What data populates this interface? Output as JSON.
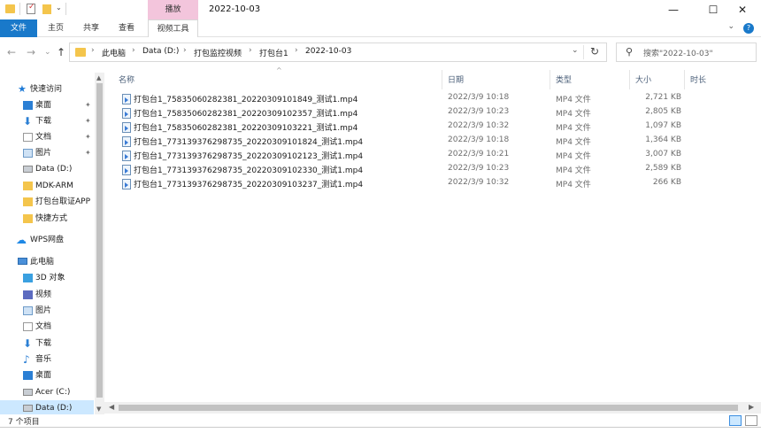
{
  "window": {
    "title": "2022-10-03",
    "context_group": "播放",
    "minimize_glyph": "—",
    "maximize_glyph": "☐",
    "close_glyph": "✕"
  },
  "ribbon": {
    "tabs": [
      "文件",
      "主页",
      "共享",
      "查看",
      "视频工具"
    ],
    "expand_glyph": "⌄",
    "help_glyph": "?"
  },
  "nav": {
    "back_glyph": "←",
    "forward_glyph": "→",
    "recent_glyph": "⌄",
    "up_glyph": "↑",
    "refresh_glyph": "↻",
    "dropdown_glyph": "⌄",
    "breadcrumb": [
      "此电脑",
      "Data (D:)",
      "打包监控视频",
      "打包台1",
      "2022-10-03"
    ],
    "separator": "›",
    "search_placeholder": "搜索\"2022-10-03\""
  },
  "navpane": {
    "items": [
      {
        "label": "快速访问",
        "icon": "star-icon",
        "pinned": false
      },
      {
        "label": "桌面",
        "icon": "desktop-icon",
        "pinned": true
      },
      {
        "label": "下载",
        "icon": "download-icon",
        "pinned": true
      },
      {
        "label": "文档",
        "icon": "document-icon",
        "pinned": true
      },
      {
        "label": "图片",
        "icon": "picture-icon",
        "pinned": true
      },
      {
        "label": "Data (D:)",
        "icon": "drive-icon",
        "pinned": false
      },
      {
        "label": "MDK-ARM",
        "icon": "folder-icon",
        "pinned": false
      },
      {
        "label": "打包台取证APP",
        "icon": "folder-icon",
        "pinned": false
      },
      {
        "label": "快捷方式",
        "icon": "shortcut-folder-icon",
        "pinned": false
      },
      {
        "label": "WPS网盘",
        "icon": "cloud-icon",
        "pinned": false
      },
      {
        "label": "此电脑",
        "icon": "computer-icon",
        "pinned": false
      },
      {
        "label": "3D 对象",
        "icon": "3d-objects-icon",
        "pinned": false
      },
      {
        "label": "视频",
        "icon": "video-icon",
        "pinned": false
      },
      {
        "label": "图片",
        "icon": "picture-icon",
        "pinned": false
      },
      {
        "label": "文档",
        "icon": "document-icon",
        "pinned": false
      },
      {
        "label": "下载",
        "icon": "download-icon",
        "pinned": false
      },
      {
        "label": "音乐",
        "icon": "music-icon",
        "pinned": false
      },
      {
        "label": "桌面",
        "icon": "desktop-icon",
        "pinned": false
      },
      {
        "label": "Acer (C:)",
        "icon": "drive-icon",
        "pinned": false
      },
      {
        "label": "Data (D:)",
        "icon": "drive-icon",
        "pinned": false
      }
    ]
  },
  "columns": {
    "name": "名称",
    "date": "日期",
    "type": "类型",
    "size": "大小",
    "duration": "时长",
    "sort_glyph": "^"
  },
  "files": [
    {
      "name": "打包台1_75835060282381_20220309101849_测试1.mp4",
      "date": "2022/3/9 10:18",
      "type": "MP4 文件",
      "size": "2,721 KB"
    },
    {
      "name": "打包台1_75835060282381_20220309102357_测试1.mp4",
      "date": "2022/3/9 10:23",
      "type": "MP4 文件",
      "size": "2,805 KB"
    },
    {
      "name": "打包台1_75835060282381_20220309103221_测试1.mp4",
      "date": "2022/3/9 10:32",
      "type": "MP4 文件",
      "size": "1,097 KB"
    },
    {
      "name": "打包台1_773139376298735_20220309101824_测试1.mp4",
      "date": "2022/3/9 10:18",
      "type": "MP4 文件",
      "size": "1,364 KB"
    },
    {
      "name": "打包台1_773139376298735_20220309102123_测试1.mp4",
      "date": "2022/3/9 10:21",
      "type": "MP4 文件",
      "size": "3,007 KB"
    },
    {
      "name": "打包台1_773139376298735_20220309102330_测试1.mp4",
      "date": "2022/3/9 10:23",
      "type": "MP4 文件",
      "size": "2,589 KB"
    },
    {
      "name": "打包台1_773139376298735_20220309103237_测试1.mp4",
      "date": "2022/3/9 10:32",
      "type": "MP4 文件",
      "size": "266 KB"
    }
  ],
  "status": {
    "item_count": "7 个项目"
  },
  "scroll": {
    "up": "▲",
    "down": "▼",
    "left": "◀",
    "right": "▶"
  },
  "pin_glyph": "📌",
  "colors": {
    "file_tab": "#1979ca",
    "context_tab": "#f3c5dc",
    "selection": "#cce8ff",
    "folder": "#f4c54c"
  }
}
